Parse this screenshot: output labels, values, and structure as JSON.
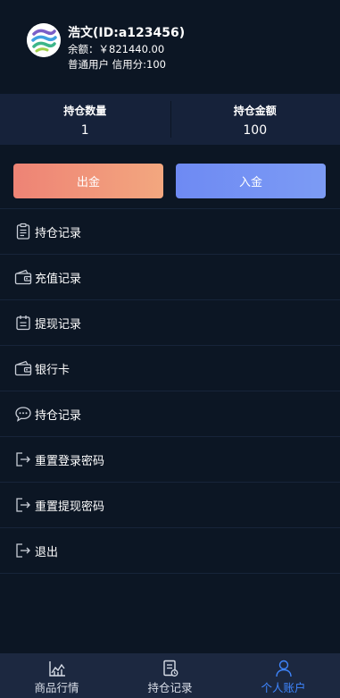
{
  "user": {
    "name": "浩文(ID:a123456)",
    "balance": "余额：￥821440.00",
    "meta": "普通用户 信用分:100"
  },
  "stats": [
    {
      "label": "持仓数量",
      "value": "1"
    },
    {
      "label": "持仓金额",
      "value": "100"
    }
  ],
  "buttons": {
    "withdraw": "出金",
    "deposit": "入金"
  },
  "menu": [
    {
      "label": "持仓记录",
      "icon": "clipboard-icon"
    },
    {
      "label": "充值记录",
      "icon": "wallet-icon"
    },
    {
      "label": "提现记录",
      "icon": "calendar-icon"
    },
    {
      "label": "银行卡",
      "icon": "bank-card-icon"
    },
    {
      "label": "持仓记录",
      "icon": "chat-bubble-icon"
    },
    {
      "label": "重置登录密码",
      "icon": "exit-arrow-icon"
    },
    {
      "label": "重置提现密码",
      "icon": "exit-arrow-icon"
    },
    {
      "label": "退出",
      "icon": "exit-arrow-icon"
    }
  ],
  "tabs": [
    {
      "label": "商品行情",
      "icon": "chart-icon",
      "active": false
    },
    {
      "label": "持仓记录",
      "icon": "document-icon",
      "active": false
    },
    {
      "label": "个人账户",
      "icon": "user-icon",
      "active": true
    }
  ],
  "colors": {
    "background": "#0c1624",
    "stats_bg": "#16223a",
    "withdraw": "#f09a7a",
    "deposit": "#7592f4",
    "tab_active": "#3f86ff",
    "tabbar_bg": "#1c2840"
  }
}
